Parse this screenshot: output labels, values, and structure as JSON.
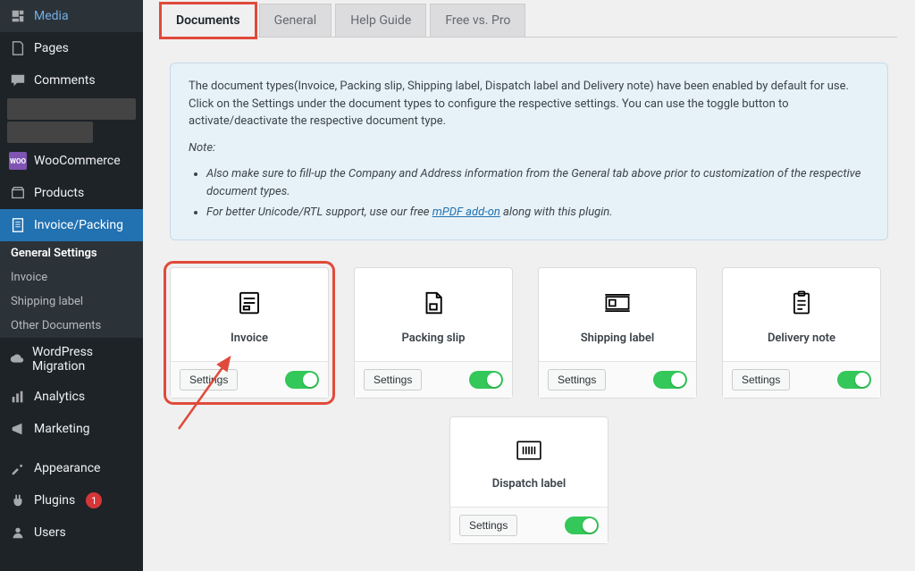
{
  "sidebar": {
    "items": [
      {
        "label": "Media"
      },
      {
        "label": "Pages"
      },
      {
        "label": "Comments"
      },
      {
        "label": "WooCommerce"
      },
      {
        "label": "Products"
      },
      {
        "label": "Invoice/Packing"
      },
      {
        "label": "WordPress Migration"
      },
      {
        "label": "Analytics"
      },
      {
        "label": "Marketing"
      },
      {
        "label": "Appearance"
      },
      {
        "label": "Plugins"
      },
      {
        "label": "Users"
      }
    ],
    "plugins_badge": "1",
    "submenu": [
      {
        "label": "General Settings",
        "current": true
      },
      {
        "label": "Invoice"
      },
      {
        "label": "Shipping label"
      },
      {
        "label": "Other Documents"
      }
    ]
  },
  "tabs": [
    {
      "label": "Documents",
      "active": true
    },
    {
      "label": "General"
    },
    {
      "label": "Help Guide"
    },
    {
      "label": "Free vs. Pro"
    }
  ],
  "notice": {
    "main": "The document types(Invoice, Packing slip, Shipping label, Dispatch label and Delivery note) have been enabled by default for use. Click on the Settings under the document types to configure the respective settings. You can use the toggle button to activate/deactivate the respective document type.",
    "note_label": "Note:",
    "bullet1_a": "Also make sure to fill-up the Company and Address information from the General tab above prior to customization of the respective document types.",
    "bullet2_a": "For better Unicode/RTL support, use our free ",
    "bullet2_link": "mPDF add-on",
    "bullet2_b": " along with this plugin."
  },
  "cards": {
    "settings_label": "Settings",
    "row1": [
      {
        "title": "Invoice"
      },
      {
        "title": "Packing slip"
      },
      {
        "title": "Shipping label"
      },
      {
        "title": "Delivery note"
      }
    ],
    "row2": [
      {
        "title": "Dispatch label"
      }
    ]
  }
}
